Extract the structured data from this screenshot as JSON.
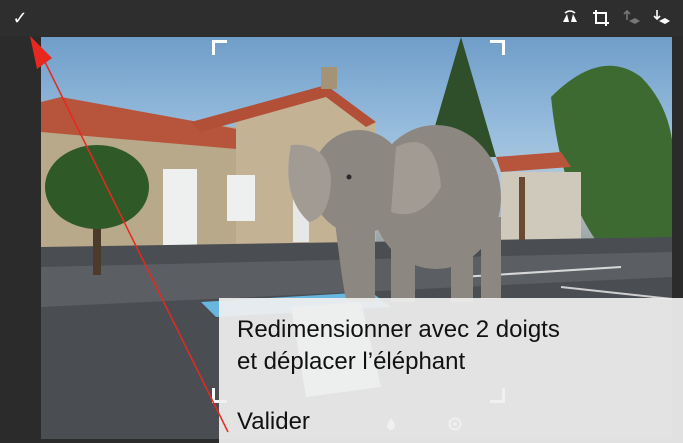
{
  "toolbar": {
    "confirm_icon": "checkmark-icon",
    "tools": [
      "flip-horizontal-icon",
      "crop-icon",
      "layer-up-icon",
      "layer-down-icon"
    ]
  },
  "image": {
    "content": "elephant cutout over a school courtyard photo"
  },
  "instructions": {
    "line1": "Redimensionner avec 2 doigts",
    "line2": "et déplacer l’éléphant",
    "confirm_hint": "Valider"
  },
  "bottom_tools": [
    "drop-icon",
    "settings-icon"
  ],
  "colors": {
    "annotation": "#e8281e",
    "toolbar_bg": "#2e2e2e",
    "tooltip_bg": "#efefef"
  }
}
